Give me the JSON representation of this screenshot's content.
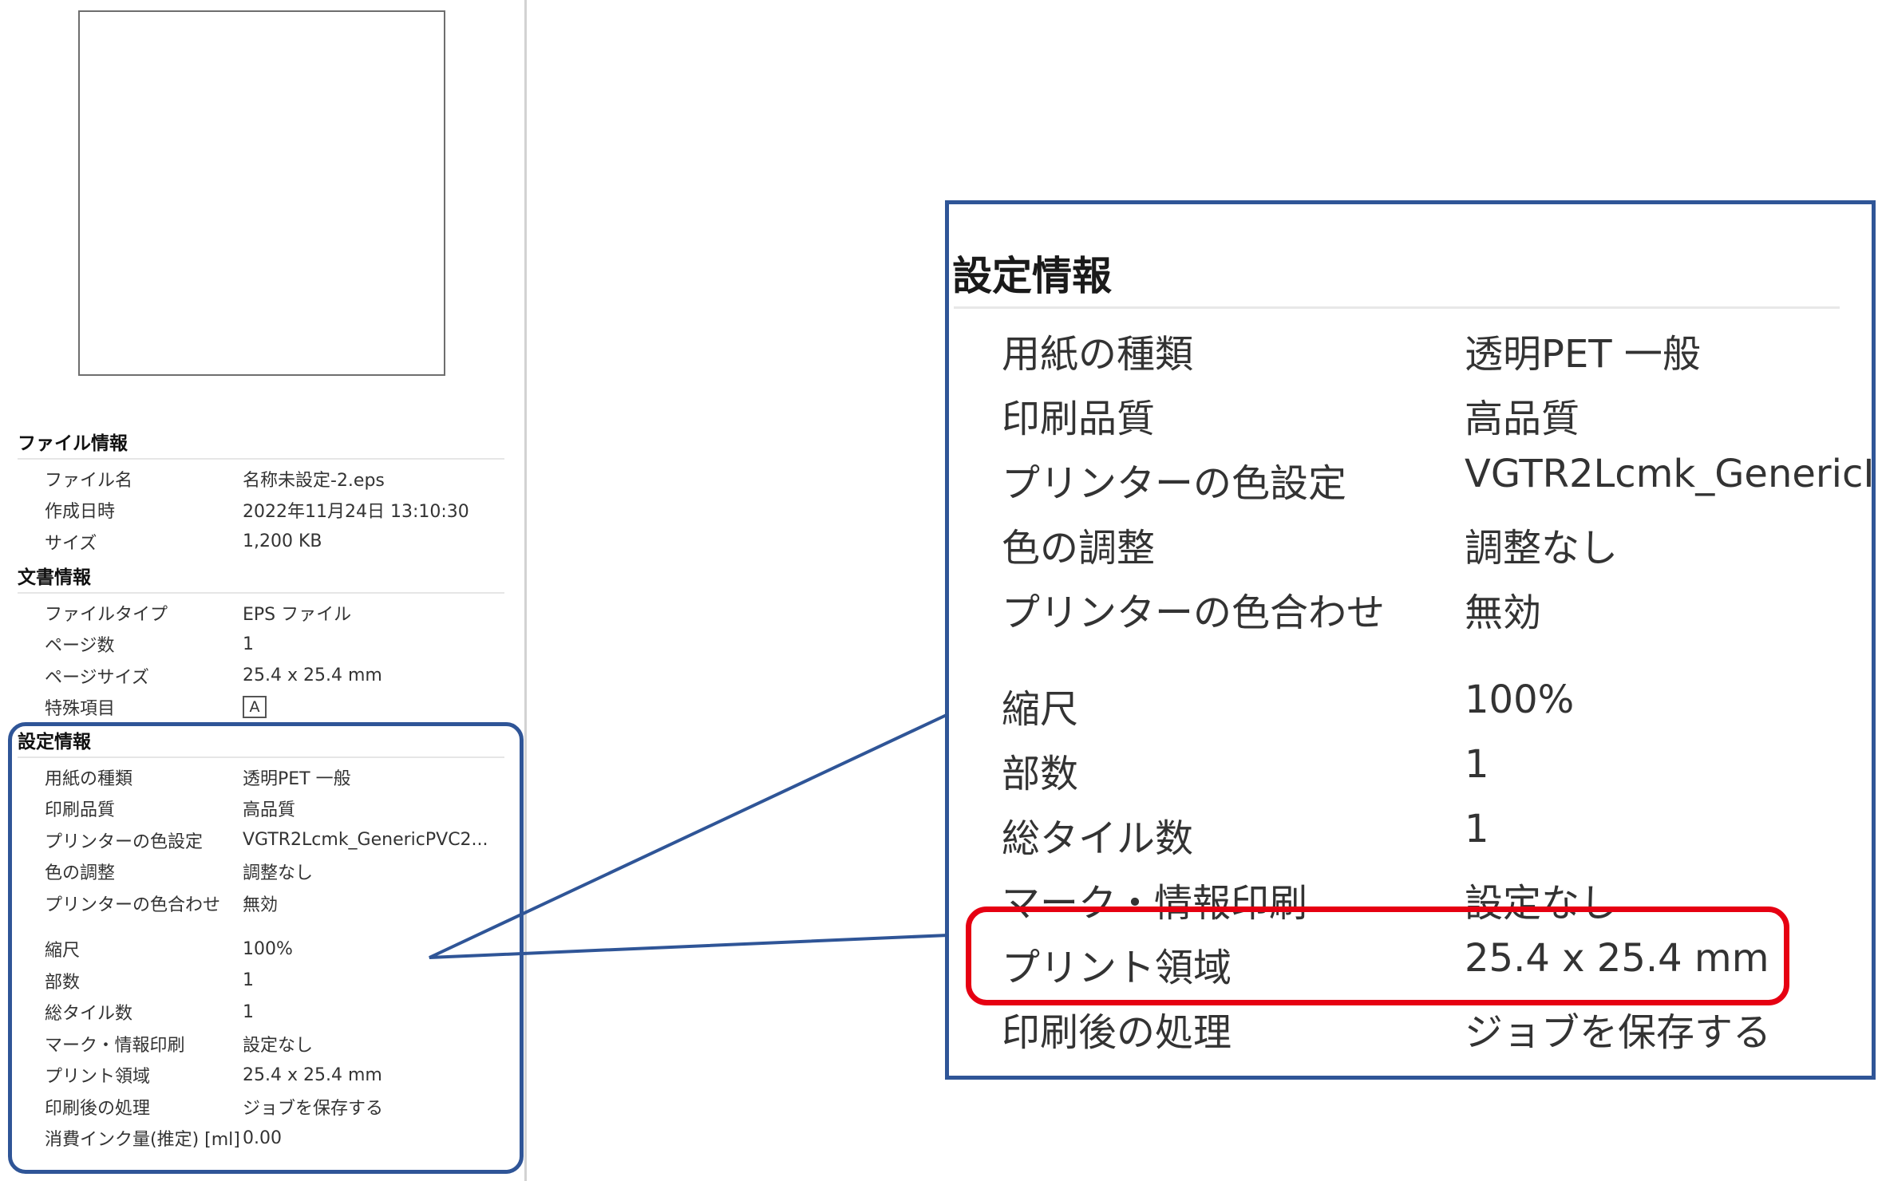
{
  "file_info": {
    "title": "ファイル情報",
    "rows": [
      {
        "label": "ファイル名",
        "value": "名称未設定-2.eps"
      },
      {
        "label": "作成日時",
        "value": "2022年11月24日 13:10:30"
      },
      {
        "label": "サイズ",
        "value": "1,200 KB"
      }
    ]
  },
  "document_info": {
    "title": "文書情報",
    "rows": [
      {
        "label": "ファイルタイプ",
        "value": "EPS ファイル"
      },
      {
        "label": "ページ数",
        "value": "1"
      },
      {
        "label": "ページサイズ",
        "value": "25.4 x 25.4 mm"
      },
      {
        "label": "特殊項目",
        "value": "A"
      }
    ]
  },
  "settings_info": {
    "title": "設定情報",
    "rows": [
      {
        "label": "用紙の種類",
        "value": "透明PET 一般"
      },
      {
        "label": "印刷品質",
        "value": "高品質"
      },
      {
        "label": "プリンターの色設定",
        "value": "VGTR2Lcmk_GenericPVC2..."
      },
      {
        "label": "色の調整",
        "value": "調整なし"
      },
      {
        "label": "プリンターの色合わせ",
        "value": "無効"
      },
      {
        "label": "縮尺",
        "value": "100%"
      },
      {
        "label": "部数",
        "value": "1"
      },
      {
        "label": "総タイル数",
        "value": "1"
      },
      {
        "label": "マーク・情報印刷",
        "value": "設定なし"
      },
      {
        "label": "プリント領域",
        "value": "25.4 x 25.4 mm"
      },
      {
        "label": "印刷後の処理",
        "value": "ジョブを保存する"
      },
      {
        "label": "消費インク量(推定) [ml]",
        "value": "0.00"
      }
    ]
  },
  "zoom": {
    "title": "設定情報",
    "rows": [
      {
        "label": "用紙の種類",
        "value": "透明PET 一般"
      },
      {
        "label": "印刷品質",
        "value": "高品質"
      },
      {
        "label": "プリンターの色設定",
        "value": "VGTR2Lcmk_GenericI"
      },
      {
        "label": "色の調整",
        "value": "調整なし"
      },
      {
        "label": "プリンターの色合わせ",
        "value": "無効"
      },
      {
        "label": "縮尺",
        "value": "100%"
      },
      {
        "label": "部数",
        "value": "1"
      },
      {
        "label": "総タイル数",
        "value": "1"
      },
      {
        "label": "マーク・情報印刷",
        "value": "設定なし"
      },
      {
        "label": "プリント領域",
        "value": "25.4 x 25.4 mm"
      },
      {
        "label": "印刷後の処理",
        "value": "ジョブを保存する"
      }
    ]
  },
  "colors": {
    "callout_blue": "#2f5597",
    "highlight_red": "#e60012"
  }
}
